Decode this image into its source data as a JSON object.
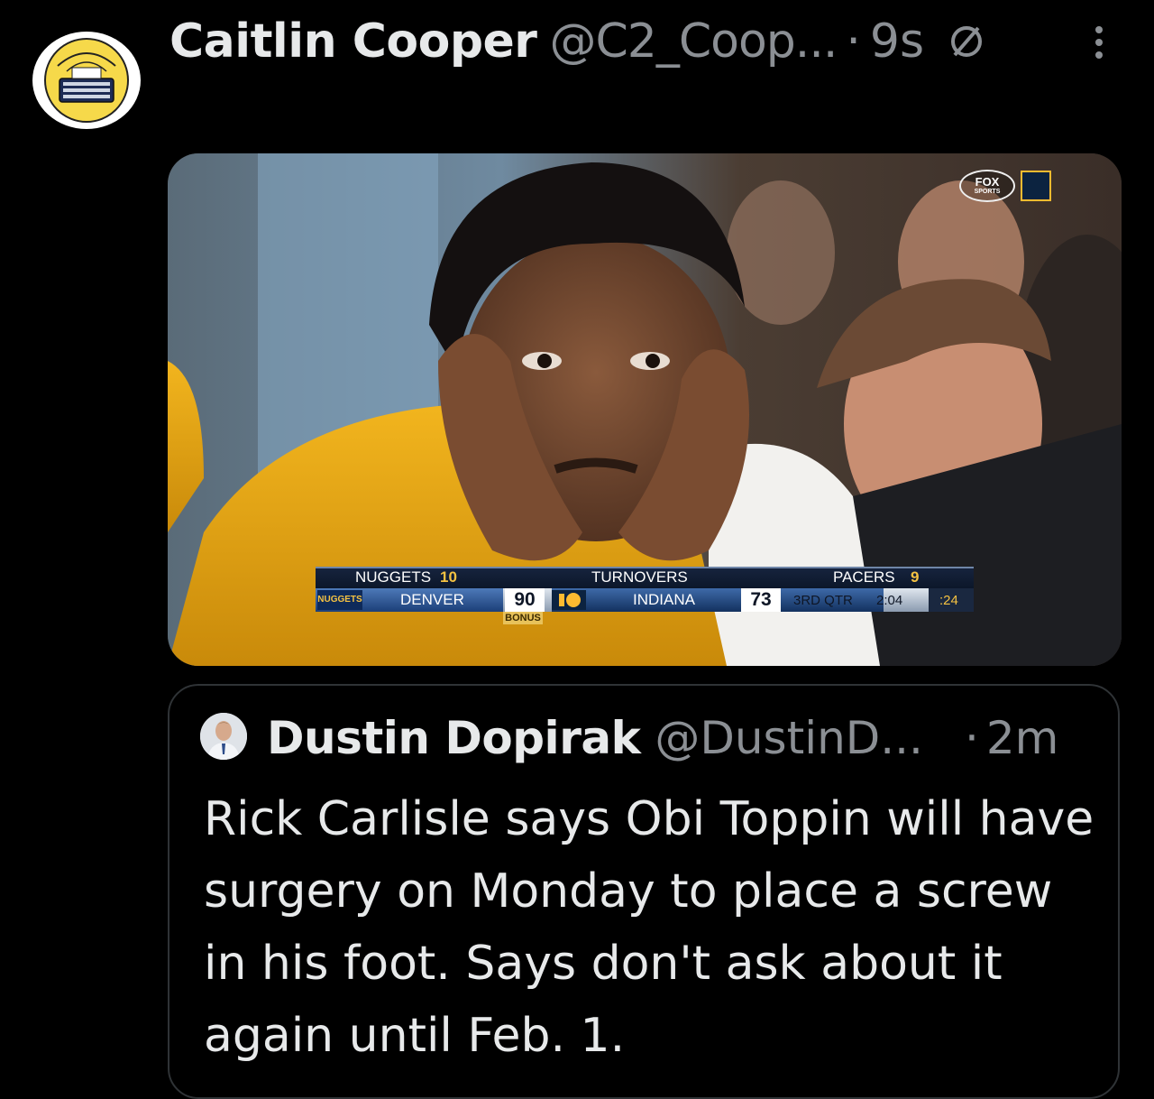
{
  "tweet": {
    "display_name": "Caitlin Cooper",
    "handle": "@C2_Coop...",
    "separator": "·",
    "time": "9s",
    "avatar_icon": "basketball-typewriter-logo",
    "more_icon": "more-vertical-icon",
    "status_icon": "no-entry-icon"
  },
  "media": {
    "network_logo_top": "FOX",
    "network_logo_bottom": "SPORTS",
    "scorebug": {
      "away_team_label": "NUGGETS",
      "away_stat": "10",
      "away_team_name": "DENVER",
      "away_logo_text": "NUGGETS",
      "away_score": "90",
      "bonus": "BONUS",
      "stat_label": "TURNOVERS",
      "home_team_label": "PACERS",
      "home_stat": "9",
      "home_team_name": "INDIANA",
      "home_score": "73",
      "period": "3RD QTR",
      "clock": "2:04",
      "shot_clock": ":24"
    },
    "colors": {
      "nuggets_navy": "#0e2a5a",
      "nuggets_gold": "#fdb927",
      "pacers_navy": "#0c2340",
      "pacers_gold": "#fdbb30"
    }
  },
  "quote": {
    "display_name": "Dustin Dopirak",
    "handle": "@DustinD...",
    "separator": "·",
    "time": "2m",
    "text": "Rick Carlisle says Obi Toppin will have surgery on Monday to place a screw in his foot. Says don't ask about it again until Feb. 1."
  },
  "theme": {
    "background": "#000000",
    "primary_text": "#e7e9ea",
    "secondary_text": "#8b8f94",
    "border": "#2f3336"
  }
}
